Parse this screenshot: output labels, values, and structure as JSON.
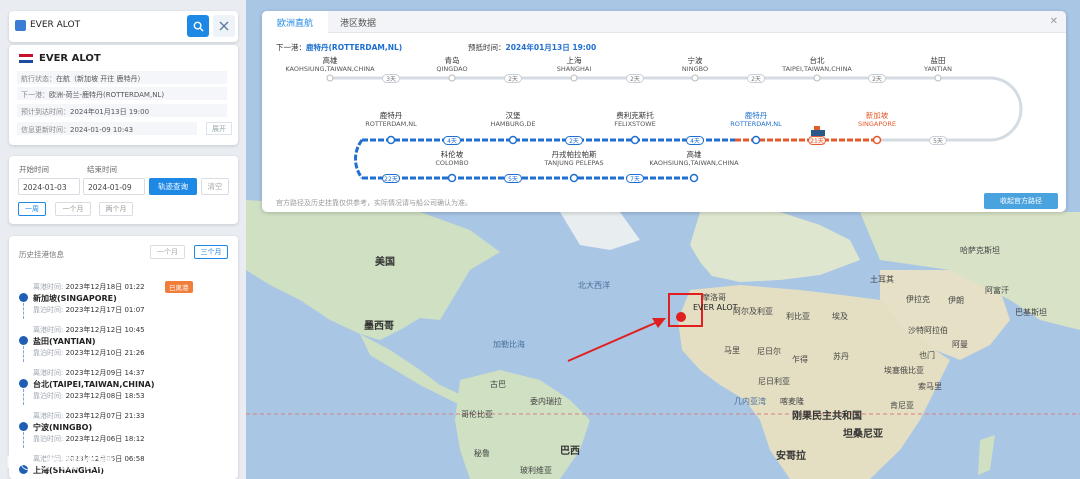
{
  "search": {
    "value": "EVER ALOT"
  },
  "vessel": {
    "name": "EVER ALOT",
    "rows": [
      {
        "k": "航行状态：",
        "v": "在航（新加坡 开往 鹿特丹）"
      },
      {
        "k": "下一港：",
        "v": "欧洲-荷兰-鹿特丹(ROTTERDAM,NL)"
      },
      {
        "k": "预计到达时间：",
        "v": "2024年01月13日 19:00"
      },
      {
        "k": "信息更新时间：",
        "v": "2024-01-09 10:43"
      }
    ],
    "expand": "展开"
  },
  "query": {
    "start_label": "开始时间",
    "end_label": "结束时间",
    "start": "2024-01-03",
    "end": "2024-01-09",
    "submit": "轨迹查询",
    "clear": "清空",
    "ranges": [
      "一周",
      "一个月",
      "两个月"
    ]
  },
  "history": {
    "title": "历史挂港信息",
    "ranges": [
      "一个月",
      "三个月"
    ],
    "ports": [
      {
        "arr_k": "离港时间:",
        "arr": "2023年12月18日 01:22",
        "badge": "已离港",
        "name": "新加坡(SINGAPORE)",
        "dep_k": "靠泊时间:",
        "dep": "2023年12月17日 01:07"
      },
      {
        "arr_k": "离港时间:",
        "arr": "2023年12月12日 10:45",
        "badge": "",
        "name": "盐田(YANTIAN)",
        "dep_k": "靠泊时间:",
        "dep": "2023年12月10日 21:26"
      },
      {
        "arr_k": "离港时间:",
        "arr": "2023年12月09日 14:37",
        "badge": "",
        "name": "台北(TAIPEI,TAIWAN,CHINA)",
        "dep_k": "靠泊时间:",
        "dep": "2023年12月08日 18:53"
      },
      {
        "arr_k": "离港时间:",
        "arr": "2023年12月07日 21:33",
        "badge": "",
        "name": "宁波(NINGBO)",
        "dep_k": "靠泊时间:",
        "dep": "2023年12月06日 18:12"
      },
      {
        "arr_k": "离港时间:",
        "arr": "2023年12月05日 06:58",
        "badge": "",
        "name": "上海(SHANGHAI)",
        "dep_k": "",
        "dep": ""
      }
    ]
  },
  "panel": {
    "tabs": [
      "欧洲直航",
      "港区数据"
    ],
    "next_k": "下一港：",
    "next_v": "鹿特丹(ROTTERDAM,NL)",
    "eta_k": "预抵时间：",
    "eta_v": "2024年01月13日 19:00",
    "route_row1": [
      {
        "cn": "高雄",
        "en": "KAOHSIUNG,TAIWAN,CHINA"
      },
      {
        "cn": "青岛",
        "en": "QINGDAO"
      },
      {
        "cn": "上海",
        "en": "SHANGHAI"
      },
      {
        "cn": "宁波",
        "en": "NINGBO"
      },
      {
        "cn": "台北",
        "en": "TAIPEI,TAIWAN,CHINA"
      },
      {
        "cn": "盐田",
        "en": "YANTIAN"
      }
    ],
    "days_row1": [
      "3天",
      "2天",
      "2天",
      "2天",
      "2天"
    ],
    "route_row2": [
      {
        "cn": "鹿特丹",
        "en": "ROTTERDAM,NL"
      },
      {
        "cn": "汉堡",
        "en": "HAMBURG,DE"
      },
      {
        "cn": "费利克斯托",
        "en": "FELIXSTOWE"
      },
      {
        "cn": "鹿特丹",
        "en": "ROTTERDAM,NL"
      },
      {
        "cn": "新加坡",
        "en": "SINGAPORE"
      }
    ],
    "days_row2": [
      "4天",
      "2天",
      "4天",
      "21天",
      "5天"
    ],
    "route_row3": [
      {
        "cn": "科伦坡",
        "en": "COLOMBO"
      },
      {
        "cn": "丹戎帕拉帕斯",
        "en": "TANJUNG PELEPAS"
      },
      {
        "cn": "高雄",
        "en": "KAOHSIUNG,TAIWAN,CHINA"
      }
    ],
    "days_row3": [
      "22天",
      "5天",
      "7天"
    ],
    "note": "官方路径及历史挂靠仅供参考，实际情况请与船公司确认为准。",
    "official_btn": "收起官方路径"
  },
  "map": {
    "labels": {
      "usa": "美国",
      "mexico": "墨西哥",
      "atlantic": "北大西洋",
      "morocco": "摩洛哥",
      "algeria": "阿尔及利亚",
      "libya": "利比亚",
      "egypt": "埃及",
      "mali": "马里",
      "niger": "尼日尔",
      "chad": "乍得",
      "sudan": "苏丹",
      "nigeria": "尼日利亚",
      "ethiopia": "埃塞俄比亚",
      "drc": "刚果民主共和国",
      "tanzania": "坦桑尼亚",
      "angola": "安哥拉",
      "brazil": "巴西",
      "peru": "秘鲁",
      "colombia": "哥伦比亚",
      "venezuela": "委内瑞拉",
      "bolivia": "玻利维亚",
      "cuba": "古巴",
      "saudi": "沙特阿拉伯",
      "iran": "伊朗",
      "iraq": "伊拉克",
      "turkey": "土耳其",
      "gulf": "几内亚湾",
      "caribbean": "加勒比海",
      "kazakhstan": "哈萨克斯坦",
      "afghanistan": "阿富汗",
      "pakistan": "巴基斯坦",
      "oman": "阿曼",
      "yemen": "也门",
      "somalia": "索马里",
      "kenya": "肯尼亚",
      "cameroon": "喀麦隆"
    },
    "ship_label": "EVER ALOT"
  },
  "watermark": "K◎ 大掘哈镜"
}
